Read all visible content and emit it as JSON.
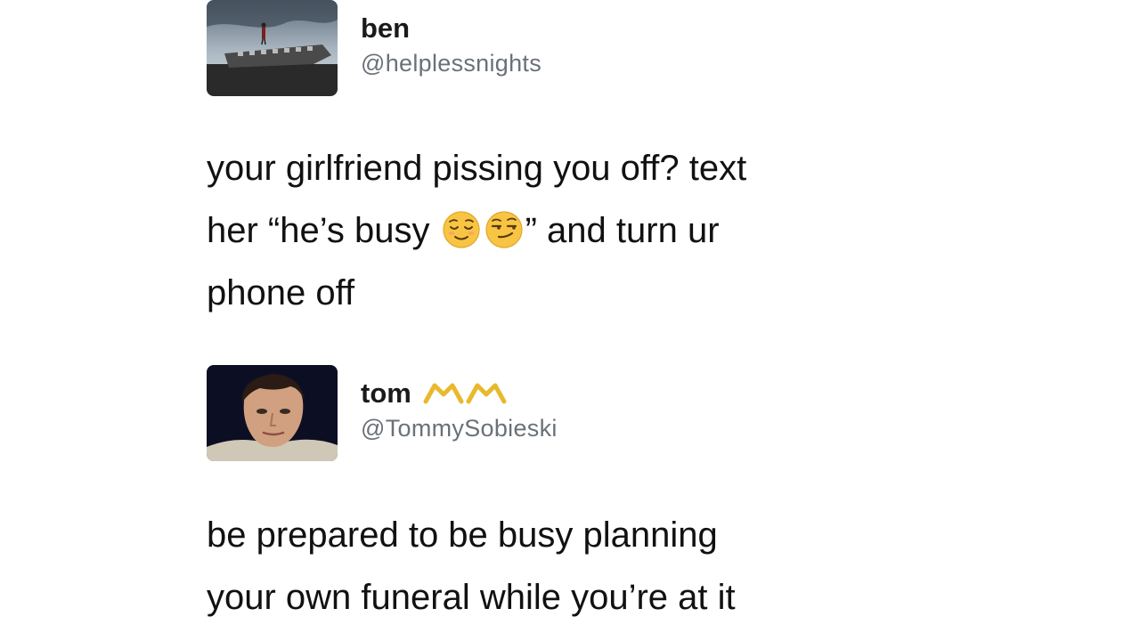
{
  "tweets": [
    {
      "display_name": "ben",
      "handle": "@helplessnights",
      "avatar": "avatar-person-on-plane-wreck",
      "text": {
        "line1": "your girlfriend pissing you off? text",
        "line2_before": "her “he’s busy ",
        "line2_after": "” and turn ur",
        "line3": "phone off"
      },
      "emojis": [
        "relieved-face-emoji",
        "smirking-face-emoji"
      ]
    },
    {
      "display_name": "tom",
      "handle": "@TommySobieski",
      "avatar": "avatar-young-man-photo",
      "name_icon": "crown-icon",
      "text": {
        "line1": "be prepared to be busy planning",
        "line2": "your own funeral while you’re at it"
      }
    }
  ],
  "colors": {
    "text": "#111111",
    "handle": "#6a7178",
    "emoji_yellow": "#f7c543",
    "crown_yellow": "#e8b92c"
  }
}
